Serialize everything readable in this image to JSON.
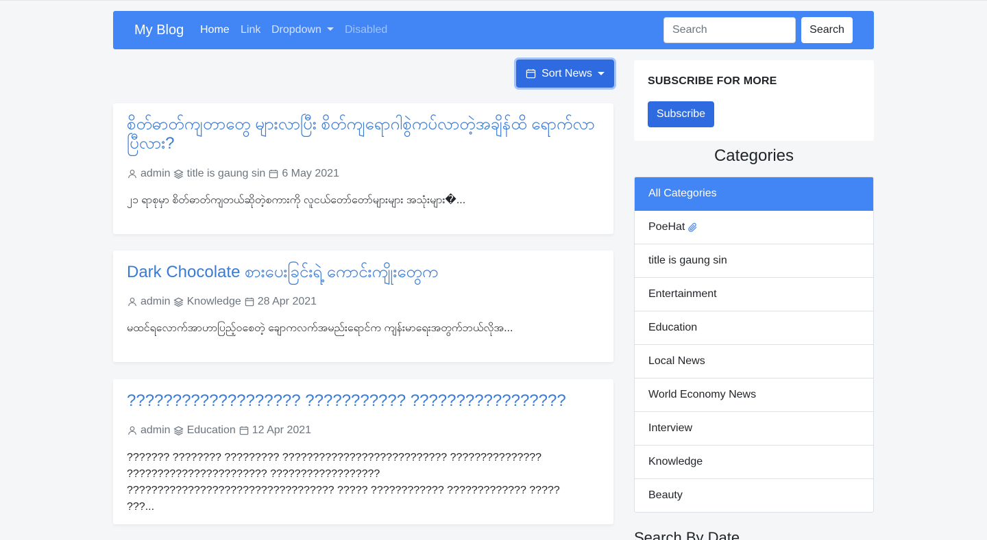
{
  "navbar": {
    "brand": "My Blog",
    "links": [
      {
        "label": "Home",
        "state": "active"
      },
      {
        "label": "Link",
        "state": "normal"
      },
      {
        "label": "Dropdown",
        "state": "dropdown"
      },
      {
        "label": "Disabled",
        "state": "disabled"
      }
    ],
    "search_placeholder": "Search",
    "search_button": "Search"
  },
  "toolbar": {
    "sort_label": "Sort News",
    "sort_icon": "calendar-icon"
  },
  "posts": [
    {
      "title": "စိတ်ဓာတ်ကျတာတွေ များလာပြီး စိတ်ကျရောဂါစွဲကပ်လာတဲ့အချိန်ထိ ရောက်လာပြီလား?",
      "author": "admin",
      "category": "title is gaung sin",
      "date": "6 May 2021",
      "excerpt": "၂၁ ရာစုမှာ စိတ်ဓာတ်ကျတယ်ဆိုတဲ့စကားကို လူငယ်တော်တော်များများ အသုံးများ�..."
    },
    {
      "title": "Dark Chocolate စားပေးခြင်းရဲ့ ကောင်းကျိုးတွေက",
      "author": "admin",
      "category": "Knowledge",
      "date": "28 Apr 2021",
      "excerpt": "မထင်ရလောက်အာဟာပြည့်ဝစေတဲ့ ချောကလက်အမည်းရောင်က ကျန်းမာရေးအတွက်ဘယ်လိုအ..."
    },
    {
      "title": "??????????????????? ??????????? ?????????????????",
      "author": "admin",
      "category": "Education",
      "date": "12 Apr 2021",
      "excerpt": "??????? ???????? ????????? ??????????????????????????? ??????????????? ??????????????????????? ?????????????????? ?????????????????????????????????? ????? ???????????? ????????????? ????? ???..."
    }
  ],
  "subscribe": {
    "title": "SUBSCRIBE FOR MORE",
    "button": "Subscribe"
  },
  "categories": {
    "heading": "Categories",
    "items": [
      {
        "label": "All Categories",
        "active": true
      },
      {
        "label": "PoeHat",
        "icon": "paperclip-icon"
      },
      {
        "label": "title is gaung sin"
      },
      {
        "label": "Entertainment"
      },
      {
        "label": "Education"
      },
      {
        "label": "Local News"
      },
      {
        "label": "World Economy News"
      },
      {
        "label": "Interview"
      },
      {
        "label": "Knowledge"
      },
      {
        "label": "Beauty"
      }
    ]
  },
  "search_by_date": {
    "heading": "Search By Date"
  },
  "colors": {
    "primary": "#4285f4",
    "button_primary": "#2e6be0",
    "post_title": "#3a7bd5",
    "muted": "#6c757d",
    "background": "#f5f6f8"
  }
}
